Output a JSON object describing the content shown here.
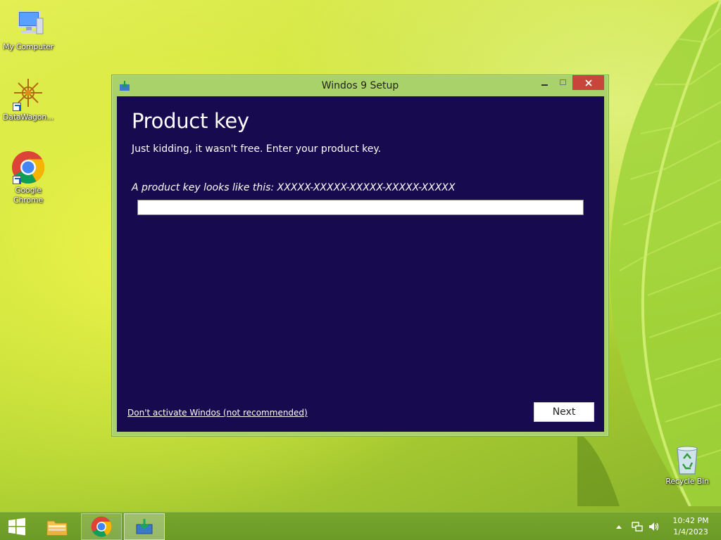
{
  "desktop": {
    "icons": [
      {
        "label": "My Computer"
      },
      {
        "label": "DataWagon..."
      },
      {
        "label": "Google Chrome"
      },
      {
        "label": "Recycle Bin"
      }
    ]
  },
  "window": {
    "title": "Windos 9 Setup",
    "heading": "Product key",
    "subtitle": "Just kidding, it wasn't free. Enter your product key.",
    "hint": "A product key looks like this: XXXXX-XXXXX-XXXXX-XXXXX-XXXXX",
    "product_key_value": "",
    "skip_link": "Don't activate Windos (not recommended)",
    "next_label": "Next"
  },
  "taskbar": {
    "time": "10:42 PM",
    "date": "1/4/2023"
  },
  "colors": {
    "window_frame": "#a9d36a",
    "window_client": "#180a4f",
    "close_button": "#c7453a",
    "taskbar": "#6b9a27"
  },
  "icons": [
    "windows-logo-icon",
    "file-explorer-icon",
    "chrome-icon",
    "setup-icon",
    "computer-icon",
    "datawagon-icon",
    "recycle-bin-icon",
    "network-icon",
    "volume-icon"
  ]
}
